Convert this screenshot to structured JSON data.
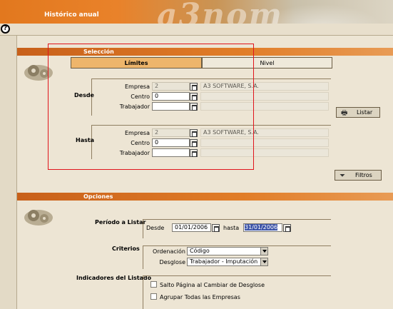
{
  "window": {
    "title": "Histórico anual",
    "logo": "a3nom"
  },
  "toolbar": {
    "help_icon": "?"
  },
  "seleccion": {
    "section_title": "Selección",
    "tabs": [
      {
        "label": "Límites",
        "active": true
      },
      {
        "label": "Nivel",
        "active": false
      }
    ],
    "desde": {
      "label": "Desde",
      "empresa_label": "Empresa",
      "empresa_value": "2",
      "empresa_name": "A3 SOFTWARE, S.A.",
      "centro_label": "Centro",
      "centro_value": "0",
      "trabajador_label": "Trabajador",
      "trabajador_value": ""
    },
    "hasta": {
      "label": "Hasta",
      "empresa_label": "Empresa",
      "empresa_value": "2",
      "empresa_name": "A3 SOFTWARE, S.A.",
      "centro_label": "Centro",
      "centro_value": "0",
      "trabajador_label": "Trabajador",
      "trabajador_value": ""
    },
    "listar_label": "Listar",
    "filtros_label": "Filtros"
  },
  "opciones": {
    "section_title": "Opciones",
    "periodo": {
      "label": "Período a Listar",
      "desde_label": "Desde",
      "desde_value": "01/01/2006",
      "hasta_label": "hasta",
      "hasta_value": "31/01/2006"
    },
    "criterios": {
      "label": "Criterios",
      "ordenacion_label": "Ordenación",
      "ordenacion_value": "Código",
      "desglose_label": "Desglose",
      "desglose_value": "Trabajador - Imputación"
    },
    "indicadores": {
      "label": "Indicadores del Listado",
      "check1_label": "Salto Página al Cambiar de Desglose",
      "check1_checked": false,
      "check2_label": "Agrupar Todas las Empresas",
      "check2_checked": false
    }
  },
  "colors": {
    "accent": "#e17d28",
    "highlight": "#e0141c",
    "selection": "#3c54a8"
  }
}
